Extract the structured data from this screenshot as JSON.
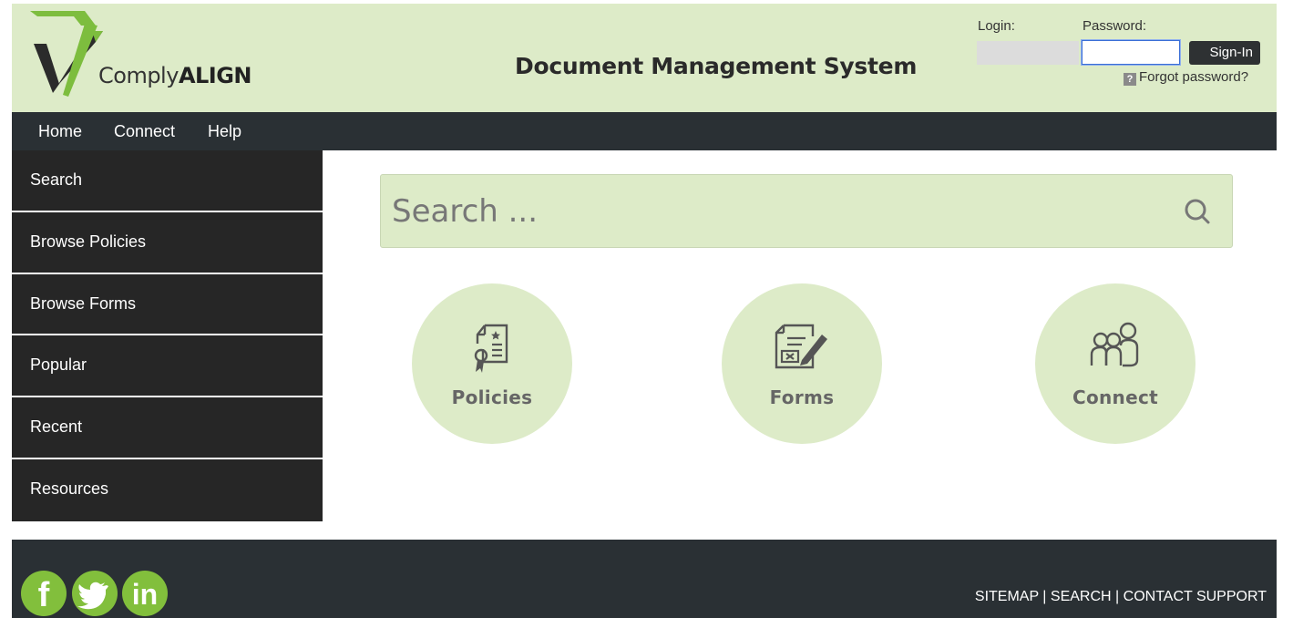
{
  "brand": {
    "logo_prefix": "Comply",
    "logo_bold": "ALIGN",
    "colors": {
      "header_bg": "#ddebc8",
      "dark": "#2a3034",
      "accent_green": "#82bf3c"
    }
  },
  "header": {
    "title": "Document Management System",
    "login_label": "Login:",
    "password_label": "Password:",
    "signin_label": "Sign-In",
    "forgot_label": "Forgot password?",
    "forgot_icon": "?"
  },
  "topnav": {
    "items": [
      {
        "label": "Home"
      },
      {
        "label": "Connect"
      },
      {
        "label": "Help"
      }
    ]
  },
  "sidebar": {
    "items": [
      {
        "label": "Search"
      },
      {
        "label": "Browse Policies"
      },
      {
        "label": "Browse Forms"
      },
      {
        "label": "Popular"
      },
      {
        "label": "Recent"
      },
      {
        "label": "Resources"
      }
    ]
  },
  "search": {
    "placeholder": "Search ...",
    "icon": "search-icon"
  },
  "tiles": [
    {
      "label": "Policies",
      "icon": "certificate-icon"
    },
    {
      "label": "Forms",
      "icon": "form-edit-icon"
    },
    {
      "label": "Connect",
      "icon": "people-icon"
    }
  ],
  "footer": {
    "social": [
      {
        "label": "f",
        "icon": "facebook-icon"
      },
      {
        "label": "twitter",
        "icon": "twitter-icon"
      },
      {
        "label": "in",
        "icon": "linkedin-icon"
      }
    ],
    "links": [
      {
        "label": "SITEMAP"
      },
      {
        "label": "SEARCH"
      },
      {
        "label": "CONTACT SUPPORT"
      }
    ],
    "separator": " | "
  }
}
